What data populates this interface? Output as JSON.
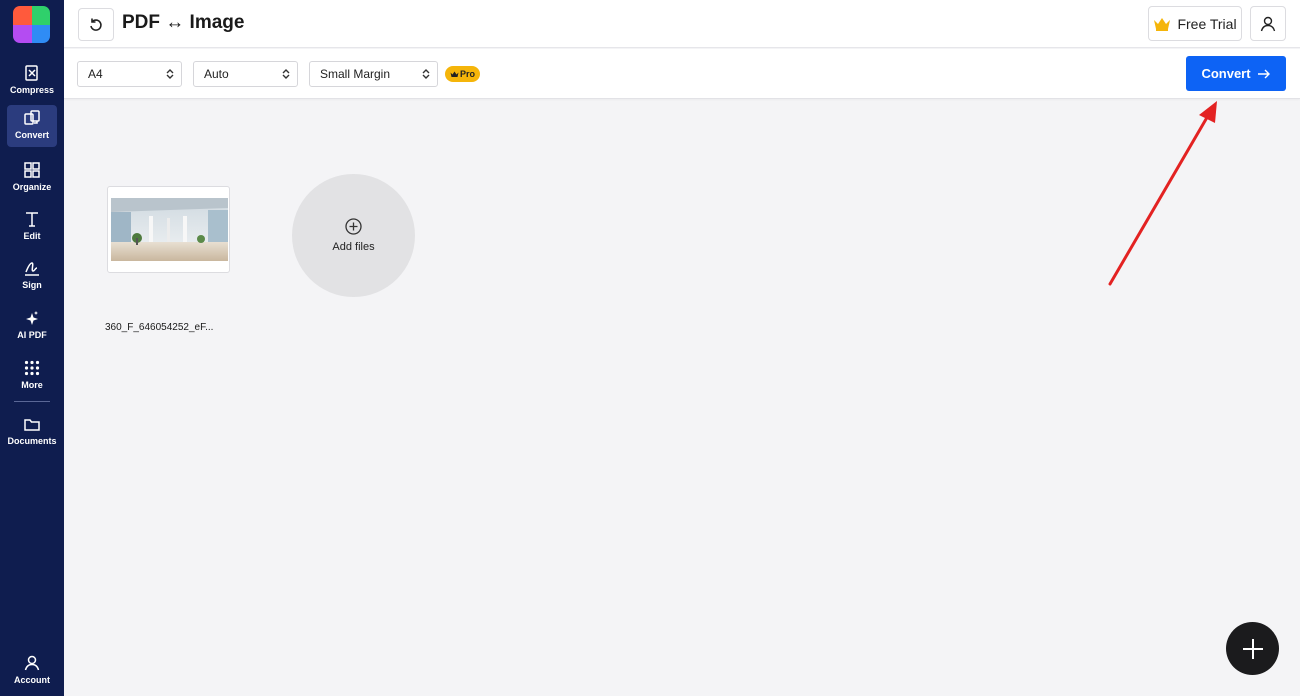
{
  "header": {
    "title": "PDF ↔ Image",
    "free_trial_label": "Free Trial"
  },
  "sidebar": {
    "items": [
      {
        "label": "Compress",
        "icon": "compress-icon"
      },
      {
        "label": "Convert",
        "icon": "convert-icon",
        "active": true
      },
      {
        "label": "Organize",
        "icon": "organize-icon"
      },
      {
        "label": "Edit",
        "icon": "edit-text-icon"
      },
      {
        "label": "Sign",
        "icon": "sign-icon"
      },
      {
        "label": "AI PDF",
        "icon": "sparkle-icon"
      },
      {
        "label": "More",
        "icon": "more-grid-icon"
      },
      {
        "label": "Documents",
        "icon": "folder-icon"
      },
      {
        "label": "Account",
        "icon": "user-icon"
      }
    ]
  },
  "toolbar": {
    "page_size": "A4",
    "orientation": "Auto",
    "margin": "Small Margin",
    "pro_badge": "Pro",
    "convert_label": "Convert"
  },
  "files": [
    {
      "name": "360_F_646054252_eF..."
    }
  ],
  "add_files_label": "Add files",
  "colors": {
    "sidebar_bg": "#0f1d4f",
    "sidebar_active": "#2b3c7e",
    "primary_button": "#0d63f5",
    "pro_badge": "#f5b50a",
    "annotation_arrow": "#e32222"
  }
}
